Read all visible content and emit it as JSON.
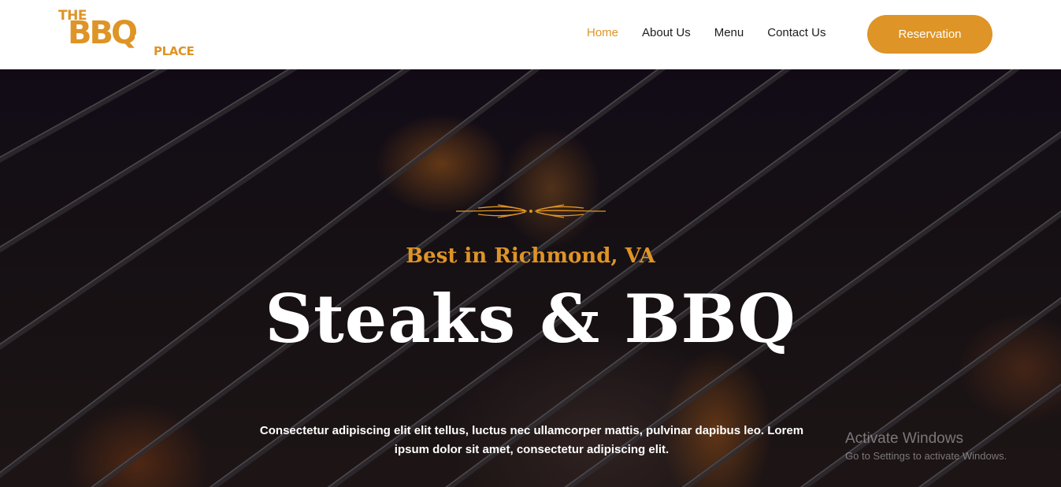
{
  "brand": {
    "logo_top": "THE",
    "logo_main": "BBQ",
    "logo_bottom": "PLACE",
    "accent_color": "#de9426"
  },
  "nav": {
    "items": [
      {
        "label": "Home",
        "active": true
      },
      {
        "label": "About Us",
        "active": false
      },
      {
        "label": "Menu",
        "active": false
      },
      {
        "label": "Contact Us",
        "active": false
      }
    ],
    "cta_label": "Reservation"
  },
  "hero": {
    "subtitle": "Best in Richmond, VA",
    "title": "Steaks & BBQ",
    "description": "Consectetur adipiscing elit elit tellus, luctus nec ullamcorper mattis, pulvinar dapibus leo. Lorem ipsum dolor sit amet, consectetur adipiscing elit."
  },
  "watermark": {
    "title": "Activate Windows",
    "subtitle": "Go to Settings to activate Windows."
  }
}
